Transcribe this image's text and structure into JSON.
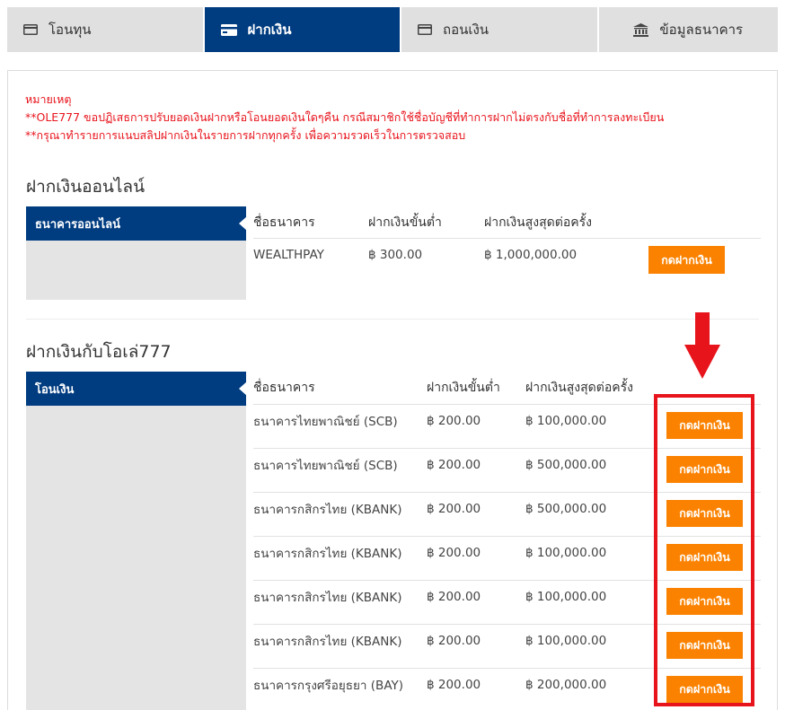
{
  "tabs": [
    {
      "label": "โอนทุน",
      "icon": "card-icon",
      "active": false
    },
    {
      "label": "ฝากเงิน",
      "icon": "card-icon",
      "active": true
    },
    {
      "label": "ถอนเงิน",
      "icon": "card-icon",
      "active": false
    },
    {
      "label": "ข้อมูลธนาคาร",
      "icon": "bank-icon",
      "active": false
    }
  ],
  "notes": {
    "heading": "หมายเหตุ",
    "line1": "**OLE777 ขอปฏิเสธการปรับยอดเงินฝากหรือโอนยอดเงินใดๆคืน กรณีสมาชิกใช้ชื่อบัญชีที่ทำการฝากไม่ตรงกับชื่อที่ทำการลงทะเบียน",
    "line2": "**กรุณาทำรายการแนบสลิปฝากเงินในรายการฝากทุกครั้ง เพื่อความรวดเร็วในการตรวจสอบ"
  },
  "online": {
    "title": "ฝากเงินออนไลน์",
    "side_label": "ธนาคารออนไลน์",
    "headers": {
      "bank": "ชื่อธนาคาร",
      "min": "ฝากเงินขั้นต่ำ",
      "max": "ฝากเงินสูงสุดต่อครั้ง"
    },
    "rows": [
      {
        "bank": "WEALTHPAY",
        "min": "฿ 300.00",
        "max": "฿ 1,000,000.00",
        "button": "กดฝากเงิน"
      }
    ]
  },
  "transfer": {
    "title": "ฝากเงินกับโอเล่777",
    "side_label": "โอนเงิน",
    "headers": {
      "bank": "ชื่อธนาคาร",
      "min": "ฝากเงินขั้นต่ำ",
      "max": "ฝากเงินสูงสุดต่อครั้ง"
    },
    "rows": [
      {
        "bank": "ธนาคารไทยพาณิชย์ (SCB)",
        "min": "฿ 200.00",
        "max": "฿ 100,000.00",
        "button": "กดฝากเงิน"
      },
      {
        "bank": "ธนาคารไทยพาณิชย์ (SCB)",
        "min": "฿ 200.00",
        "max": "฿ 500,000.00",
        "button": "กดฝากเงิน"
      },
      {
        "bank": "ธนาคารกสิกรไทย (KBANK)",
        "min": "฿ 200.00",
        "max": "฿ 500,000.00",
        "button": "กดฝากเงิน"
      },
      {
        "bank": "ธนาคารกสิกรไทย (KBANK)",
        "min": "฿ 200.00",
        "max": "฿ 100,000.00",
        "button": "กดฝากเงิน"
      },
      {
        "bank": "ธนาคารกสิกรไทย (KBANK)",
        "min": "฿ 200.00",
        "max": "฿ 100,000.00",
        "button": "กดฝากเงิน"
      },
      {
        "bank": "ธนาคารกสิกรไทย (KBANK)",
        "min": "฿ 200.00",
        "max": "฿ 100,000.00",
        "button": "กดฝากเงิน"
      },
      {
        "bank": "ธนาคารกรุงศรีอยุธยา (BAY)",
        "min": "฿ 200.00",
        "max": "฿ 200,000.00",
        "button": "กดฝากเงิน"
      }
    ]
  },
  "colors": {
    "primary": "#003c80",
    "button": "#fb8200",
    "alert": "#e8141c",
    "tab_inactive": "#e0e0e0"
  },
  "annotation": {
    "arrow": "red-down-arrow-icon",
    "frame": "highlight-frame"
  }
}
